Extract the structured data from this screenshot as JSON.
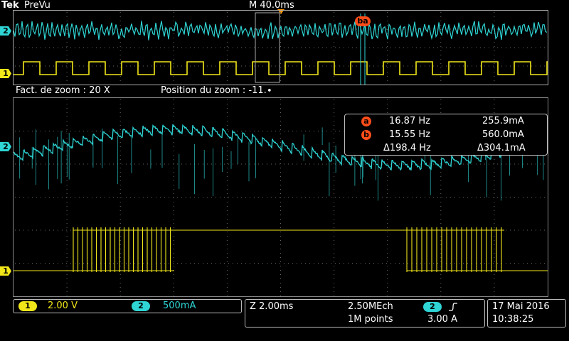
{
  "header": {
    "brand": "Tek",
    "mode": "PreVu",
    "timebase": "M 40.0ms"
  },
  "overview": {
    "cursor_marker": "ba",
    "channel_labels": [
      "2",
      "1"
    ]
  },
  "zoom_bar": {
    "factor_label": "Fact. de zoom : 20 X",
    "position_label": "Position du zoom  : -11.∙"
  },
  "main_view": {
    "channel_labels": [
      "2",
      "1"
    ]
  },
  "measurements": {
    "cursor_a": {
      "marker": "a",
      "freq": "16.87 Hz",
      "current": "255.9mA"
    },
    "cursor_b": {
      "marker": "b",
      "freq": "15.55 Hz",
      "current": "560.0mA"
    },
    "delta": {
      "freq": "Δ198.4 Hz",
      "current": "Δ304.1mA"
    }
  },
  "channels": {
    "ch1": {
      "number": "1",
      "scale": "2.00 V"
    },
    "ch2": {
      "number": "2",
      "scale": "500mA"
    }
  },
  "horizontal": {
    "zoom_scale": "Z 2.00ms",
    "sample_rate": "2.50MEch",
    "record_length": "1M points",
    "trigger_channel": "2",
    "trigger_slope_icon": "rising-edge-icon",
    "trigger_level": "3.00 A"
  },
  "datetime": {
    "date": "17 Mai  2016",
    "time": "10:38:25"
  },
  "colors": {
    "ch1": "#f1e61a",
    "ch2": "#2fd4d4",
    "cursor": "#ff4d1a",
    "trigger": "#ff9900"
  }
}
